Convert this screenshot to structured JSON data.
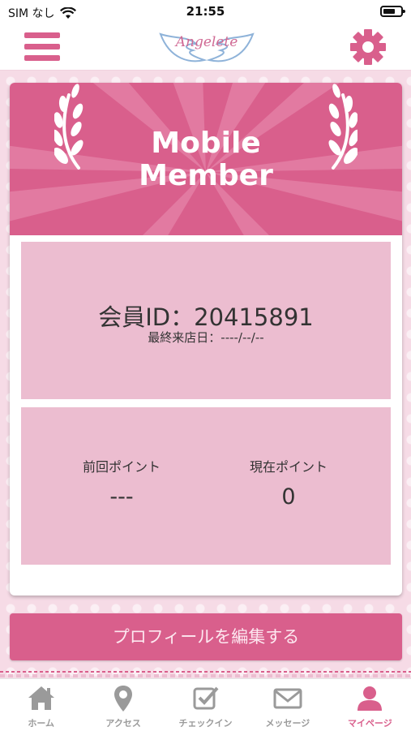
{
  "status_bar": {
    "carrier": "SIM なし",
    "time": "21:55"
  },
  "header": {
    "logo_text": "Angelete",
    "menu_icon": "hamburger-icon",
    "settings_icon": "gear-icon"
  },
  "banner": {
    "title_line1": "Mobile",
    "title_line2": "Member"
  },
  "member": {
    "id_text": "会員ID：20415891",
    "last_visit": "最終来店日：----/--/--"
  },
  "points": {
    "previous_label": "前回ポイント",
    "previous_value": "---",
    "current_label": "現在ポイント",
    "current_value": "0"
  },
  "edit_button": "プロフィールを編集する",
  "tabs": [
    {
      "label": "ホーム",
      "icon": "home-icon"
    },
    {
      "label": "アクセス",
      "icon": "map-pin-icon"
    },
    {
      "label": "チェックイン",
      "icon": "checkbox-icon"
    },
    {
      "label": "メッセージ",
      "icon": "envelope-icon"
    },
    {
      "label": "マイページ",
      "icon": "user-icon"
    }
  ],
  "colors": {
    "accent": "#d95f8c",
    "panel": "#ecbdd0",
    "tab_inactive": "#9a9a9a"
  }
}
